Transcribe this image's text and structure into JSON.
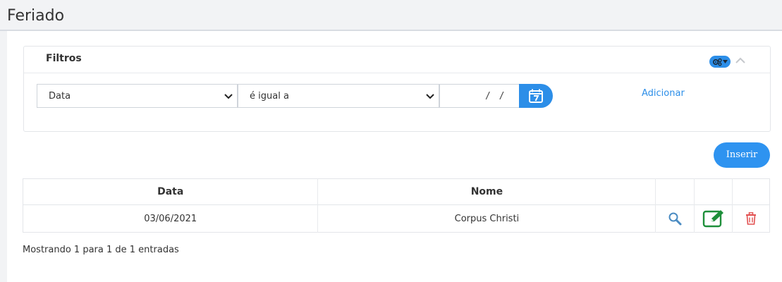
{
  "page": {
    "title": "Feriado"
  },
  "filters": {
    "title": "Filtros",
    "field_select": {
      "value": "Data"
    },
    "operator_select": {
      "value": "é igual a"
    },
    "date_input": {
      "value": "/ /"
    },
    "add_label": "Adicionar",
    "colors": {
      "accent": "#2c8ee8"
    }
  },
  "toolbar": {
    "insert_label": "Inserir"
  },
  "table": {
    "columns": [
      "Data",
      "Nome",
      "",
      "",
      ""
    ],
    "rows": [
      {
        "data": "03/06/2021",
        "nome": "Corpus Christi"
      }
    ],
    "icons": [
      "search-icon",
      "edit-icon",
      "trash-icon"
    ],
    "colors": {
      "search": "#4a8bc2",
      "edit": "#1e8f3a",
      "delete": "#e25050"
    }
  },
  "pagination": {
    "info": "Mostrando 1 para 1 de 1 entradas"
  }
}
